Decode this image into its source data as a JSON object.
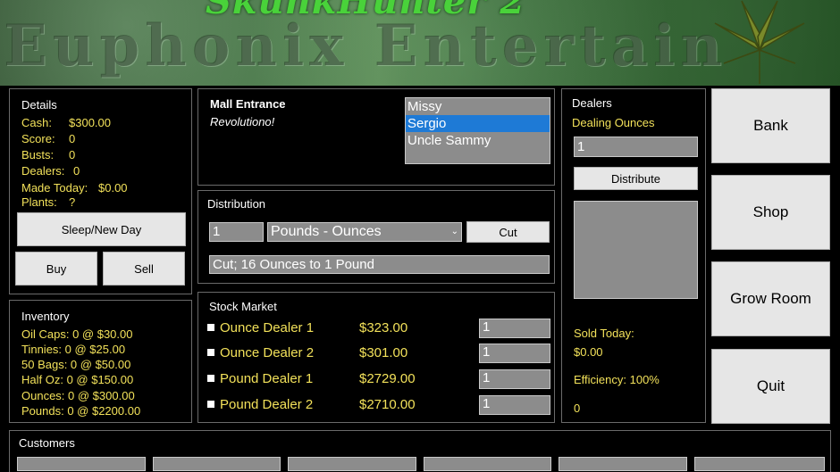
{
  "banner": {
    "top_text": "SkunkHunter 2",
    "main_text": "Euphonix Entertain"
  },
  "details": {
    "heading": "Details",
    "cash_label": "Cash:",
    "cash_value": "$300.00",
    "score_label": "Score:",
    "score_value": "0",
    "busts_label": "Busts:",
    "busts_value": "0",
    "dealers_label": "Dealers:",
    "dealers_value": "0",
    "made_today_label": "Made Today:",
    "made_today_value": "$0.00",
    "plants_label": "Plants:",
    "plants_value": "?",
    "sleep_button": "Sleep/New Day",
    "buy_button": "Buy",
    "sell_button": "Sell"
  },
  "inventory": {
    "heading": "Inventory",
    "items": [
      "Oil Caps: 0 @ $30.00",
      "Tinnies: 0 @ $25.00",
      "50 Bags: 0 @ $50.00",
      "Half Oz: 0 @ $150.00",
      "Ounces: 0 @ $300.00",
      "Pounds: 0 @ $2200.00"
    ]
  },
  "location": {
    "name": "Mall Entrance",
    "subtitle": "Revolutiono!",
    "people": [
      "Missy",
      "Sergio",
      "Uncle Sammy"
    ],
    "selected_person": "Sergio"
  },
  "distribution": {
    "heading": "Distribution",
    "quantity": "1",
    "unit_select": "Pounds - Ounces",
    "cut_button": "Cut",
    "status": "Cut; 16 Ounces to 1 Pound"
  },
  "stock_market": {
    "heading": "Stock Market",
    "rows": [
      {
        "name": "Ounce Dealer 1",
        "price": "$323.00",
        "qty": "1"
      },
      {
        "name": "Ounce Dealer 2",
        "price": "$301.00",
        "qty": "1"
      },
      {
        "name": "Pound Dealer 1",
        "price": "$2729.00",
        "qty": "1"
      },
      {
        "name": "Pound Dealer 2",
        "price": "$2710.00",
        "qty": "1"
      }
    ]
  },
  "dealers": {
    "heading": "Dealers",
    "mode": "Dealing Ounces",
    "quantity": "1",
    "distribute_button": "Distribute",
    "sold_today_label": "Sold Today:",
    "sold_today_value": "$0.00",
    "efficiency": "Efficiency: 100%",
    "count": "0"
  },
  "side_buttons": {
    "bank": "Bank",
    "shop": "Shop",
    "grow_room": "Grow Room",
    "quit": "Quit"
  },
  "customers": {
    "heading": "Customers"
  },
  "colors": {
    "accent_yellow": "#f2e15a",
    "selection_blue": "#1e7ad6",
    "field_gray": "#8c8c8c"
  }
}
